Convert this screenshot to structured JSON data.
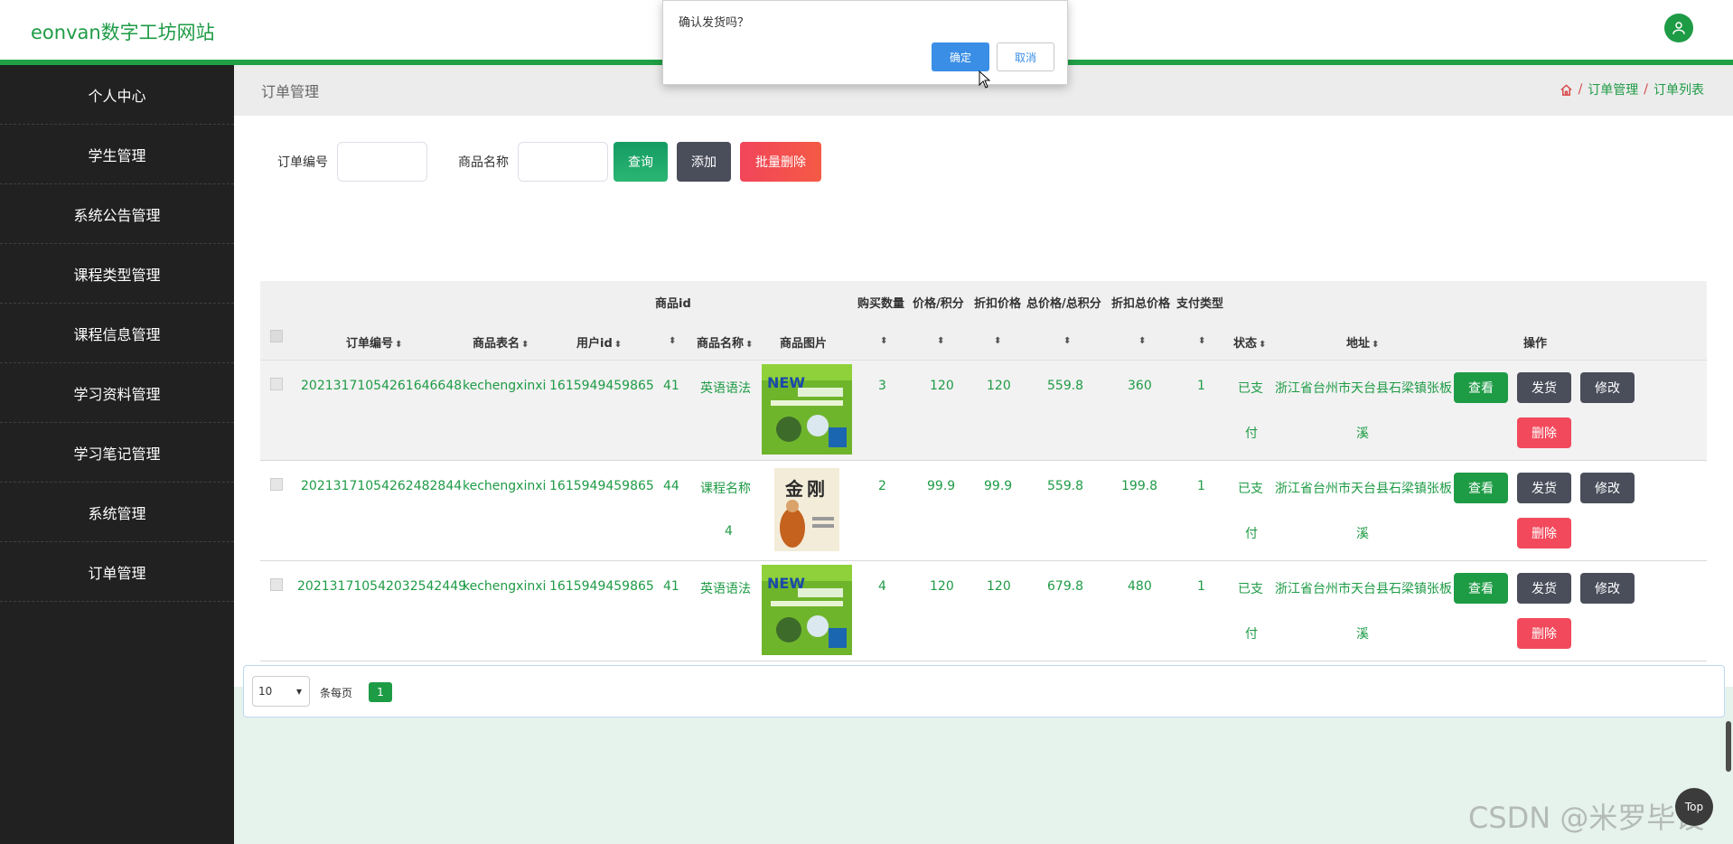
{
  "header": {
    "brand": "eonvan数字工坊网站"
  },
  "sidebar": {
    "items": [
      {
        "label": "个人中心"
      },
      {
        "label": "学生管理"
      },
      {
        "label": "系统公告管理"
      },
      {
        "label": "课程类型管理"
      },
      {
        "label": "课程信息管理"
      },
      {
        "label": "学习资料管理"
      },
      {
        "label": "学习笔记管理"
      },
      {
        "label": "系统管理"
      },
      {
        "label": "订单管理"
      }
    ]
  },
  "breadcrumb": {
    "title": "订单管理",
    "sep": "/",
    "items": [
      "订单管理",
      "订单列表"
    ]
  },
  "search": {
    "order_no_label": "订单编号",
    "product_name_label": "商品名称",
    "order_no_value": "",
    "product_name_value": "",
    "query_label": "查询",
    "add_label": "添加",
    "batch_delete_label": "批量删除"
  },
  "table": {
    "top_headers": {
      "product_id": "商品id",
      "quantity": "购买数量",
      "price": "价格/积分",
      "discount_price": "折扣价格",
      "total_price": "总价格/总积分",
      "discount_total": "折扣总价格",
      "pay_type": "支付类型"
    },
    "headers": {
      "order_no": "订单编号",
      "table_name": "商品表名",
      "user_id": "用户id",
      "product_name": "商品名称",
      "image": "商品图片",
      "status": "状态",
      "address": "地址",
      "actions": "操作"
    },
    "rows": [
      {
        "order_no": "2021317105426164664​8",
        "table_name": "kechengxinxi",
        "user_id": "1615949459865",
        "product_id": "41",
        "product_name_1": "英语语法",
        "product_name_2": "",
        "quantity": "3",
        "price": "120",
        "discount_price": "120",
        "total_price": "559.8",
        "discount_total": "360",
        "pay_type": "1",
        "status_1": "已支",
        "status_2": "付",
        "address_1": "浙江省台州市天台县石梁镇张板",
        "address_2": "溪",
        "image": "new-english-book"
      },
      {
        "order_no": "20213171054262482844",
        "table_name": "kechengxinxi",
        "user_id": "1615949459865",
        "product_id": "44",
        "product_name_1": "课程名称",
        "product_name_2": "4",
        "quantity": "2",
        "price": "99.9",
        "discount_price": "99.9",
        "total_price": "559.8",
        "discount_total": "199.8",
        "pay_type": "1",
        "status_1": "已支",
        "status_2": "付",
        "address_1": "浙江省台州市天台县石梁镇张板",
        "address_2": "溪",
        "image": "jin-gang-book"
      },
      {
        "order_no": "20213171054203254244​9",
        "table_name": "kechengxinxi",
        "user_id": "1615949459865",
        "product_id": "41",
        "product_name_1": "英语语法",
        "product_name_2": "",
        "quantity": "4",
        "price": "120",
        "discount_price": "120",
        "total_price": "679.8",
        "discount_total": "480",
        "pay_type": "1",
        "status_1": "已支",
        "status_2": "付",
        "address_1": "浙江省台州市天台县石梁镇张板",
        "address_2": "溪",
        "image": "new-english-book"
      }
    ],
    "action_labels": {
      "view": "查看",
      "ship": "发货",
      "edit": "修改",
      "delete": "删除"
    }
  },
  "pagination": {
    "page_size": "10",
    "per_page_text": "条每页",
    "current_page": "1"
  },
  "dialog": {
    "message": "确认发货吗？",
    "ok": "确定",
    "cancel": "取消"
  },
  "watermark": "CSDN @米罗毕设",
  "scroll_top_label": "Top",
  "colors": {
    "accent": "#1e9b45",
    "danger": "#f24a5c",
    "dark_button": "#4a4e5b",
    "sidebar": "#212121"
  }
}
